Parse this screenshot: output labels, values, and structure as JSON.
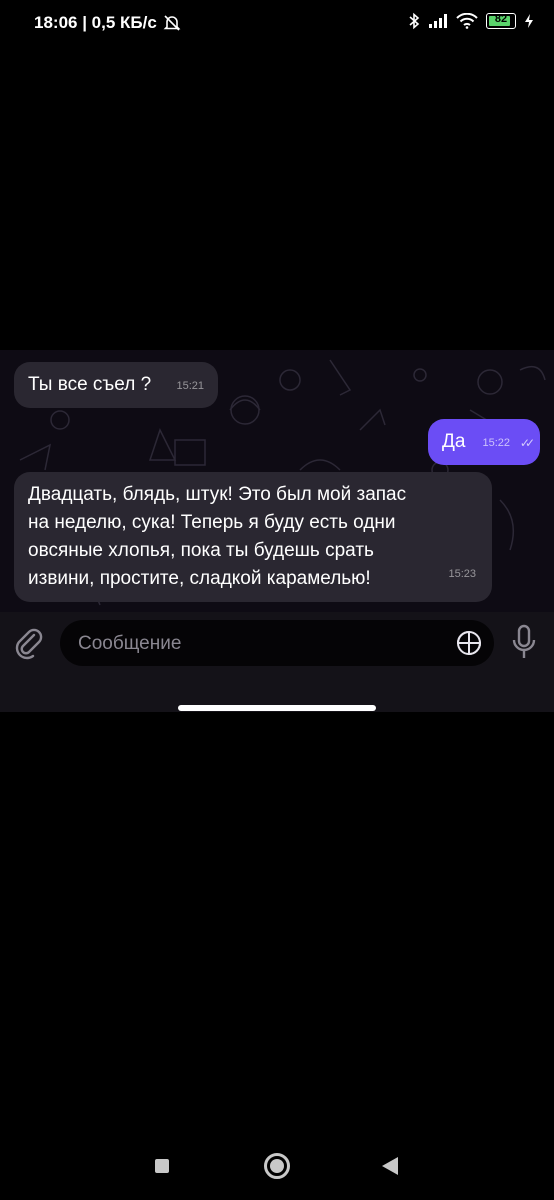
{
  "status_bar": {
    "time_speed": "18:06 | 0,5 КБ/с",
    "battery": "82",
    "icons": [
      "mute-bell-icon",
      "bluetooth-icon",
      "signal-icon",
      "wifi-icon",
      "battery-icon",
      "charging-icon"
    ]
  },
  "messages": [
    {
      "direction": "incoming",
      "text": "Ты все съел ?",
      "time": "15:21"
    },
    {
      "direction": "outgoing",
      "text": "Да",
      "time": "15:22",
      "read": true
    },
    {
      "direction": "incoming",
      "text": "Двадцать,  блядь, штук!  Это был мой запас\nна неделю,  сука!  Теперь я буду есть одни\nовсяные хлопья,  пока ты  будешь  срать\nизвини, простите,  сладкой  карамелью!",
      "time": "15:23"
    }
  ],
  "composer": {
    "placeholder": "Сообщение"
  },
  "colors": {
    "incoming_bubble": "#2a2731",
    "outgoing_bubble": "#6b4df5",
    "chat_background": "#0e0b14",
    "battery_fill": "#5ad36b"
  }
}
